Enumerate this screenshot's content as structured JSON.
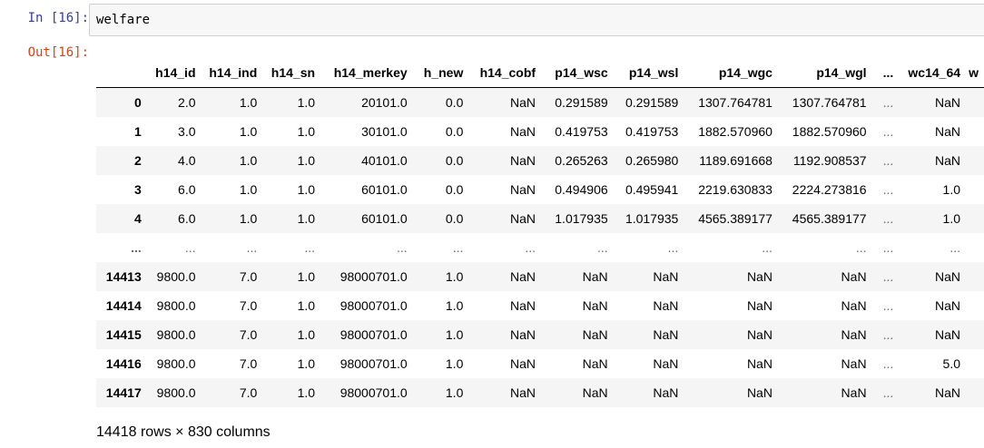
{
  "input_cell": {
    "prompt": "In [16]:",
    "code": "welfare"
  },
  "output_cell": {
    "prompt": "Out[16]:"
  },
  "dataframe": {
    "columns": [
      "",
      "h14_id",
      "h14_ind",
      "h14_sn",
      "h14_merkey",
      "h_new",
      "h14_cobf",
      "p14_wsc",
      "p14_wsl",
      "p14_wgc",
      "p14_wgl",
      "...",
      "wc14_64",
      "w"
    ],
    "rows": [
      [
        "0",
        "2.0",
        "1.0",
        "1.0",
        "20101.0",
        "0.0",
        "NaN",
        "0.291589",
        "0.291589",
        "1307.764781",
        "1307.764781",
        "...",
        "NaN",
        ""
      ],
      [
        "1",
        "3.0",
        "1.0",
        "1.0",
        "30101.0",
        "0.0",
        "NaN",
        "0.419753",
        "0.419753",
        "1882.570960",
        "1882.570960",
        "...",
        "NaN",
        ""
      ],
      [
        "2",
        "4.0",
        "1.0",
        "1.0",
        "40101.0",
        "0.0",
        "NaN",
        "0.265263",
        "0.265980",
        "1189.691668",
        "1192.908537",
        "...",
        "NaN",
        ""
      ],
      [
        "3",
        "6.0",
        "1.0",
        "1.0",
        "60101.0",
        "0.0",
        "NaN",
        "0.494906",
        "0.495941",
        "2219.630833",
        "2224.273816",
        "...",
        "1.0",
        ""
      ],
      [
        "4",
        "6.0",
        "1.0",
        "1.0",
        "60101.0",
        "0.0",
        "NaN",
        "1.017935",
        "1.017935",
        "4565.389177",
        "4565.389177",
        "...",
        "1.0",
        ""
      ],
      [
        "...",
        "...",
        "...",
        "...",
        "...",
        "...",
        "...",
        "...",
        "...",
        "...",
        "...",
        "...",
        "...",
        ""
      ],
      [
        "14413",
        "9800.0",
        "7.0",
        "1.0",
        "98000701.0",
        "1.0",
        "NaN",
        "NaN",
        "NaN",
        "NaN",
        "NaN",
        "...",
        "NaN",
        ""
      ],
      [
        "14414",
        "9800.0",
        "7.0",
        "1.0",
        "98000701.0",
        "1.0",
        "NaN",
        "NaN",
        "NaN",
        "NaN",
        "NaN",
        "...",
        "NaN",
        ""
      ],
      [
        "14415",
        "9800.0",
        "7.0",
        "1.0",
        "98000701.0",
        "1.0",
        "NaN",
        "NaN",
        "NaN",
        "NaN",
        "NaN",
        "...",
        "NaN",
        ""
      ],
      [
        "14416",
        "9800.0",
        "7.0",
        "1.0",
        "98000701.0",
        "1.0",
        "NaN",
        "NaN",
        "NaN",
        "NaN",
        "NaN",
        "...",
        "5.0",
        ""
      ],
      [
        "14417",
        "9800.0",
        "7.0",
        "1.0",
        "98000701.0",
        "1.0",
        "NaN",
        "NaN",
        "NaN",
        "NaN",
        "NaN",
        "...",
        "NaN",
        ""
      ]
    ]
  },
  "shape_text": "14418 rows × 830 columns"
}
